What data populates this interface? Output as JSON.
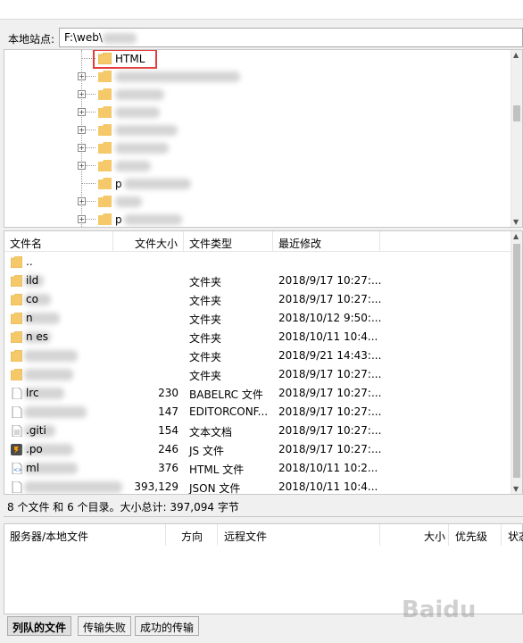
{
  "site_bar": {
    "label": "本地站点:",
    "path": "F:\\web\\"
  },
  "tree": {
    "highlighted_folder": "HTML",
    "partial_letters": [
      "p",
      "p"
    ]
  },
  "file_list": {
    "columns": {
      "name": "文件名",
      "size": "文件大小",
      "type": "文件类型",
      "modified": "最近修改"
    },
    "rows": [
      {
        "name": "..",
        "size": "",
        "type": "",
        "modified": "",
        "icon": "folder-icon"
      },
      {
        "name": "ild",
        "size": "",
        "type": "文件夹",
        "modified": "2018/9/17 10:27:...",
        "icon": "folder-icon"
      },
      {
        "name": "co",
        "size": "",
        "type": "文件夹",
        "modified": "2018/9/17 10:27:...",
        "icon": "folder-icon"
      },
      {
        "name": "n",
        "size": "",
        "type": "文件夹",
        "modified": "2018/10/12 9:50:...",
        "icon": "folder-icon"
      },
      {
        "name": "n es",
        "size": "",
        "type": "文件夹",
        "modified": "2018/10/11 10:4...",
        "icon": "folder-icon"
      },
      {
        "name": "",
        "size": "",
        "type": "文件夹",
        "modified": "2018/9/21 14:43:...",
        "icon": "folder-icon"
      },
      {
        "name": "",
        "size": "",
        "type": "文件夹",
        "modified": "2018/9/17 10:27:...",
        "icon": "folder-icon"
      },
      {
        "name": "lrc",
        "size": "230",
        "type": "BABELRC 文件",
        "modified": "2018/9/17 10:27:...",
        "icon": "file-icon"
      },
      {
        "name": "",
        "size": "147",
        "type": "EDITORCONF...",
        "modified": "2018/9/17 10:27:...",
        "icon": "file-icon"
      },
      {
        "name": ".giti",
        "size": "154",
        "type": "文本文档",
        "modified": "2018/9/17 10:27:...",
        "icon": "text-file-icon"
      },
      {
        "name": ".po",
        "size": "246",
        "type": "JS 文件",
        "modified": "2018/9/17 10:27:...",
        "icon": "js-file-icon"
      },
      {
        "name": "ml",
        "size": "376",
        "type": "HTML 文件",
        "modified": "2018/10/11 10:2...",
        "icon": "html-file-icon"
      },
      {
        "name": "",
        "size": "393,129",
        "type": "JSON 文件",
        "modified": "2018/10/11 10:4...",
        "icon": "file-icon"
      }
    ]
  },
  "status": "8 个文件 和 6 个目录。大小总计: 397,094 字节",
  "queue": {
    "columns": {
      "server_local": "服务器/本地文件",
      "direction": "方向",
      "remote": "远程文件",
      "size": "大小",
      "priority": "优先级",
      "state": "状态"
    }
  },
  "tabs": [
    "列队的文件",
    "传输失败",
    "成功的传输"
  ],
  "watermark": "Baidu",
  "colors": {
    "folder": "#f5c96a",
    "highlight": "#e53b3b"
  }
}
